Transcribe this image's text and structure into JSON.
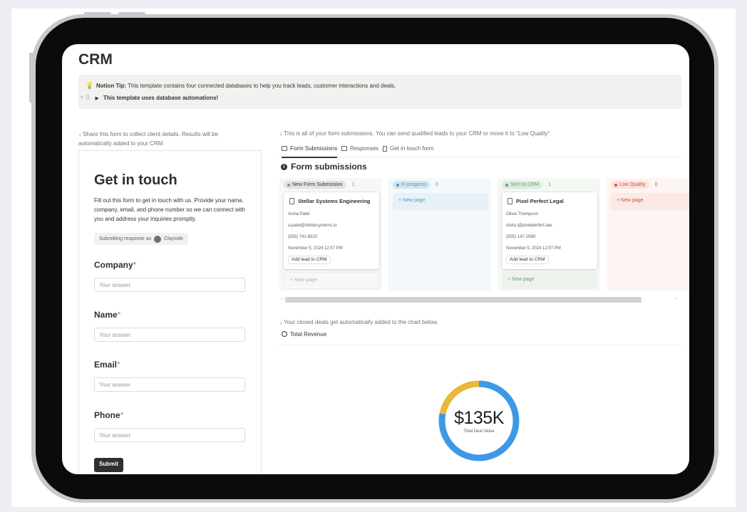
{
  "page": {
    "title": "CRM"
  },
  "callout": {
    "icon": "lightbulb-icon",
    "tip_label": "Notion Tip:",
    "tip_text": " This template contains four connected databases to help you track leads, customer interactions and deals.",
    "toggle_label": "This template uses database automations!"
  },
  "form": {
    "caption": "↓ Share this form to collect client details. Results will be automatically added to your CRM.",
    "heading": "Get in touch",
    "description": "Fill out this form to get in touch with us. Provide your name, company, email, and phone number so we can connect with you and address your inquiries promptly.",
    "responding_as": "Submitting response as",
    "user": "Clayside",
    "required_mark": "*",
    "fields": [
      {
        "label": "Company",
        "placeholder": "Your answer"
      },
      {
        "label": "Name",
        "placeholder": "Your answer"
      },
      {
        "label": "Email",
        "placeholder": "Your answer"
      },
      {
        "label": "Phone",
        "placeholder": "Your answer"
      }
    ],
    "submit_label": "Submit"
  },
  "submissions": {
    "caption": "↓ This is all of your form submissions. You can send qualified leads to your CRM or move it to \"Low Quality\".",
    "tabs": [
      {
        "label": "Form Submissions",
        "icon": "board-icon"
      },
      {
        "label": "Responses",
        "icon": "table-icon"
      },
      {
        "label": "Get in touch form",
        "icon": "form-icon"
      }
    ],
    "title": "Form submissions",
    "new_page_label": "+ New page",
    "columns": [
      {
        "label": "New Form Submission",
        "count": "1",
        "color": "#91918e",
        "pill_bg": "#e3e2e0",
        "col_bg": "#f7f7f5"
      },
      {
        "label": "In progress",
        "count": "0",
        "color": "#5b97bd",
        "pill_bg": "#d3e5ef",
        "col_bg": "#f2f8fb"
      },
      {
        "label": "Sent to CRM",
        "count": "1",
        "color": "#6c9b7d",
        "pill_bg": "#dbeddb",
        "col_bg": "#f4f8f3"
      },
      {
        "label": "Low Quality",
        "count": "0",
        "color": "#d44c47",
        "pill_bg": "#ffe2dd",
        "col_bg": "#fdf5f2"
      }
    ],
    "cards": [
      {
        "title": "Stellar Systems Engineering",
        "name": "Aisha Patel",
        "email": "a.patel@stellarsystems.io",
        "phone": "(555) 741-8520",
        "date": "November 5, 2024 12:57 PM",
        "action": "Add lead to CRM"
      },
      {
        "title": "Pixel Perfect Legal",
        "name": "Olivia Thompson",
        "email": "olivia.t@pixelperfect.law",
        "phone": "(555) 147-2589",
        "date": "November 5, 2024 12:57 PM",
        "action": "Add lead to CRM"
      }
    ]
  },
  "revenue": {
    "caption": "↓ Your closed deals get automatically added to the chart below.",
    "tab_label": "Total Revenue",
    "value": "$135K",
    "sublabel": "Total Deal Value",
    "segments": [
      {
        "share": 0.78,
        "color": "#3d99e6"
      },
      {
        "share": 0.22,
        "color": "#e9b83a"
      }
    ]
  }
}
